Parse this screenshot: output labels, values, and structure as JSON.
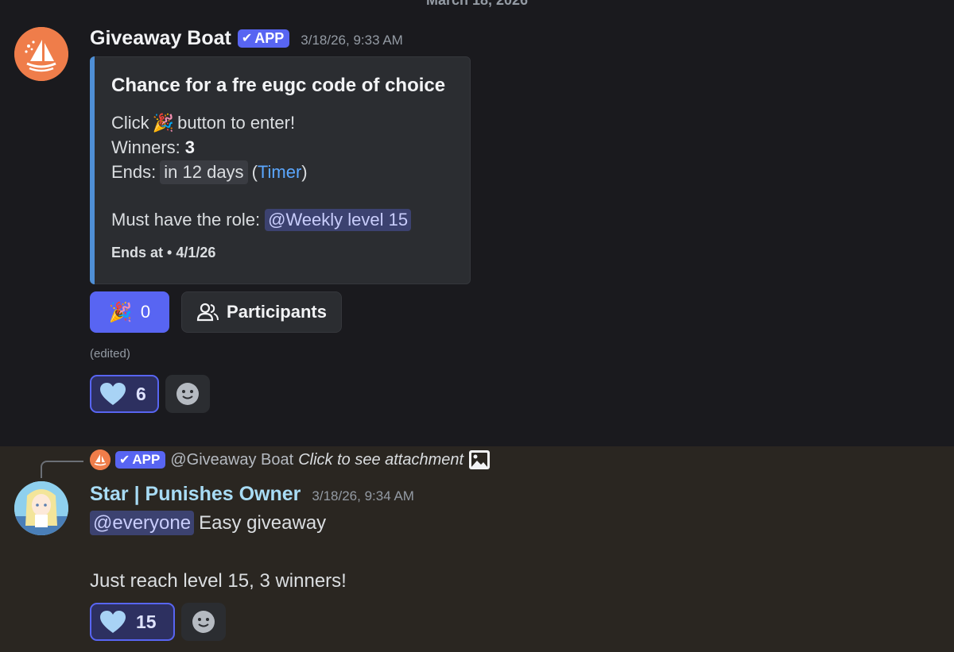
{
  "date_divider": "March 18, 2026",
  "message1": {
    "author": "Giveaway Boat",
    "app_tag": "APP",
    "timestamp": "3/18/26, 9:33 AM",
    "embed": {
      "title": "Chance for a fre eugc code of choice",
      "line1_pre": "Click",
      "line1_post": "button to enter!",
      "winners_label": "Winners:",
      "winners_value": "3",
      "ends_label": "Ends:",
      "ends_value": "in 12 days",
      "ends_link_open": "(",
      "ends_link": "Timer",
      "ends_link_close": ")",
      "role_label": "Must have the role:",
      "role_mention": "@Weekly level 15",
      "footer": "Ends at • 4/1/26",
      "accent_color": "#4f8fd6"
    },
    "enter_button": {
      "icon": "party-popper-icon",
      "count": "0"
    },
    "participants_button": {
      "icon": "users-icon",
      "label": "Participants"
    },
    "edited_label": "(edited)",
    "reaction": {
      "icon": "heart-icon",
      "count": "6"
    }
  },
  "message2": {
    "reply": {
      "app_tag": "APP",
      "author": "@Giveaway Boat",
      "text": "Click to see attachment"
    },
    "author": "Star | Punishes Owner",
    "timestamp": "3/18/26, 9:34 AM",
    "mention": "@everyone",
    "line1": "Easy giveaway",
    "line2": "Just reach level 15, 3 winners!",
    "reaction": {
      "icon": "heart-icon",
      "count": "15"
    }
  },
  "colors": {
    "blurple": "#5865f2",
    "background": "#1a1a1e",
    "highlight_background": "#2a2621",
    "link": "#5ba7ff"
  }
}
